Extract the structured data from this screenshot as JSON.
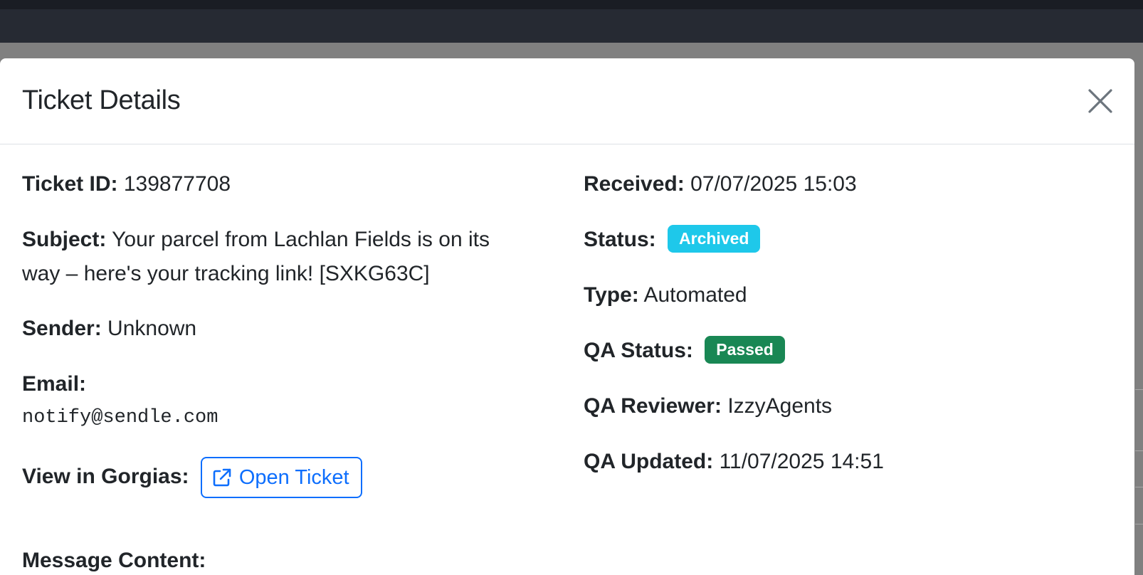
{
  "modal": {
    "title": "Ticket Details",
    "close_icon": "close-icon"
  },
  "left": {
    "ticket_id_label": "Ticket ID:",
    "ticket_id_value": "139877708",
    "subject_label": "Subject:",
    "subject_value_line1": "Your parcel from Lachlan Fields is on its",
    "subject_value_line2": "way – here's your tracking link! [SXKG63C]",
    "sender_label": "Sender:",
    "sender_value": "Unknown",
    "email_label": "Email:",
    "email_value": "notify@sendle.com",
    "gorgias_label": "View in Gorgias:",
    "open_ticket_label": "Open Ticket",
    "open_ticket_icon": "external-link-icon"
  },
  "right": {
    "received_label": "Received:",
    "received_value": "07/07/2025 15:03",
    "status_label": "Status:",
    "status_value": "Archived",
    "type_label": "Type:",
    "type_value": "Automated",
    "qa_status_label": "QA Status:",
    "qa_status_value": "Passed",
    "qa_reviewer_label": "QA Reviewer:",
    "qa_reviewer_value": "IzzyAgents",
    "qa_updated_label": "QA Updated:",
    "qa_updated_value": "11/07/2025 14:51"
  },
  "message": {
    "heading": "Message Content:"
  },
  "colors": {
    "status_archived": "#1ec8ea",
    "qa_passed": "#198754",
    "link_blue": "#0d6efd"
  }
}
